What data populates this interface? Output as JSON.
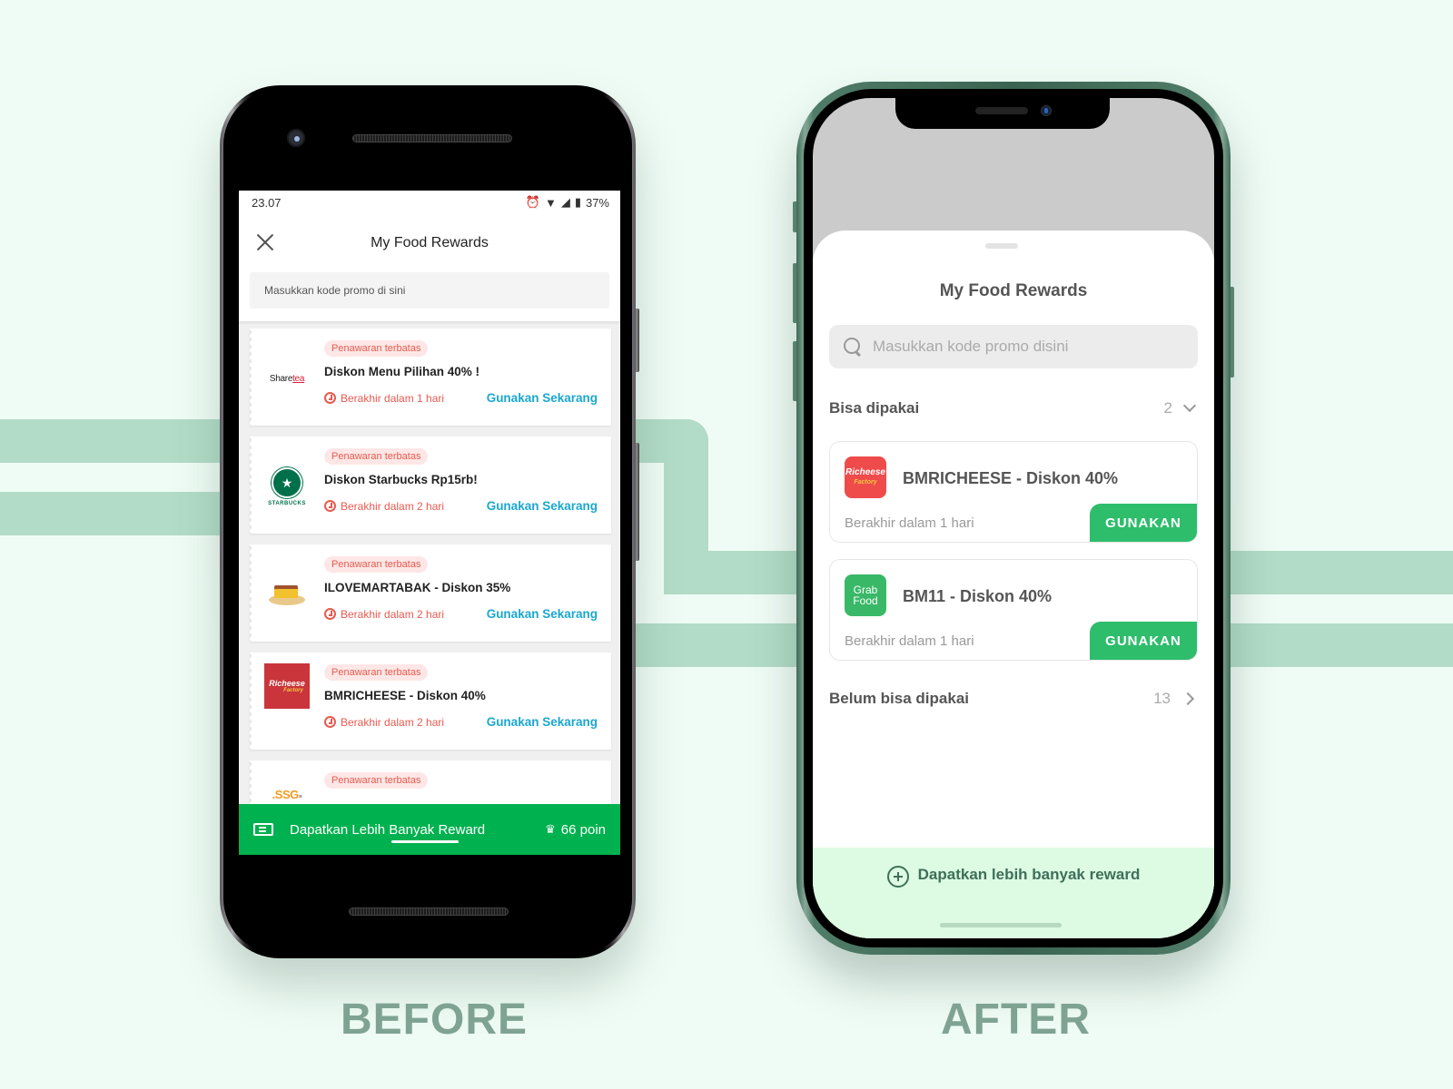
{
  "captions": {
    "before": "BEFORE",
    "after": "AFTER"
  },
  "colors": {
    "grab_green": "#00b14f",
    "accent_green": "#2ebd6b",
    "link_blue": "#1ba7cf",
    "alert_red": "#e85a4f",
    "stripe": "#b2dcc7"
  },
  "before": {
    "status_bar": {
      "time": "23.07",
      "battery": "37%",
      "icons": [
        "alarm-icon",
        "wifi-icon",
        "signal-icon",
        "battery-icon"
      ]
    },
    "header": {
      "title": "My Food Rewards",
      "close_icon": "close-icon"
    },
    "search": {
      "placeholder": "Masukkan kode promo di sini",
      "value": ""
    },
    "rewards": [
      {
        "merchant": "Sharetea",
        "badge": "Penawaran terbatas",
        "name": "Diskon Menu Pilihan  40% !",
        "expiry": "Berakhir dalam 1 hari",
        "action": "Gunakan Sekarang"
      },
      {
        "merchant": "Starbucks",
        "badge": "Penawaran terbatas",
        "name": "Diskon Starbucks Rp15rb!",
        "expiry": "Berakhir dalam 2 hari",
        "action": "Gunakan Sekarang"
      },
      {
        "merchant": "ILoveMartabak",
        "badge": "Penawaran terbatas",
        "name": "ILOVEMARTABAK - Diskon 35%",
        "expiry": "Berakhir dalam 2 hari",
        "action": "Gunakan Sekarang"
      },
      {
        "merchant": "Richeese Factory",
        "badge": "Penawaran terbatas",
        "name": "BMRICHEESE - Diskon 40%",
        "expiry": "Berakhir dalam 2 hari",
        "action": "Gunakan Sekarang"
      },
      {
        "merchant": "SSG",
        "badge": "Penawaran terbatas",
        "name": "",
        "expiry": "",
        "action": ""
      }
    ],
    "bottom_bar": {
      "label": "Dapatkan Lebih Banyak Reward",
      "points": "66 poin"
    }
  },
  "after": {
    "header": {
      "title": "My Food Rewards"
    },
    "search": {
      "placeholder": "Masukkan kode promo disini",
      "value": ""
    },
    "usable": {
      "label": "Bisa dipakai",
      "count": "2",
      "items": [
        {
          "logo": "Richeese",
          "logo_sub": "Factory",
          "logo_color": "#ef4b4b",
          "name": "BMRICHEESE - Diskon 40%",
          "expiry": "Berakhir dalam 1 hari",
          "action": "GUNAKAN"
        },
        {
          "logo": "Grab",
          "logo_sub": "Food",
          "logo_color": "#39b867",
          "name": "BM11 - Diskon 40%",
          "expiry": "Berakhir dalam 1 hari",
          "action": "GUNAKAN"
        }
      ]
    },
    "unusable": {
      "label": "Belum bisa dipakai",
      "count": "13"
    },
    "footer": {
      "label": "Dapatkan lebih banyak reward"
    }
  }
}
